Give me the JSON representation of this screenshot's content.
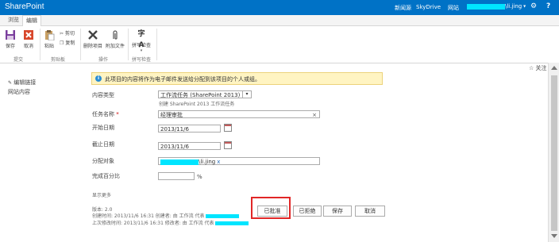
{
  "topbar": {
    "brand": "SharePoint",
    "links": [
      "新闻源",
      "SkyDrive",
      "网站"
    ],
    "user_suffix": "\\li.jing",
    "gear_icon": "gear-icon",
    "help_icon": "?"
  },
  "tabs": [
    "浏览",
    "编辑"
  ],
  "ribbon": {
    "buttons": {
      "save": "保存",
      "cancel": "取消",
      "paste": "粘贴",
      "cut": "剪切",
      "copy": "复制",
      "delete_item": "删除项目",
      "attach_file": "附加文件",
      "spelling": "拼写检查"
    },
    "groups": {
      "commit": "提交",
      "clipboard": "剪贴板",
      "actions": "操作",
      "spelling": "拼写检查"
    }
  },
  "follow": "关注",
  "leftnav": [
    "编辑链接",
    "网站内容"
  ],
  "info_message": "此项目的内容将作为电子邮件发送给分配到该项目的个人或组。",
  "form": {
    "content_type_label": "内容类型",
    "content_type_value": "工作流任务 (SharePoint 2013)",
    "content_type_desc": "创建 SharePoint 2013 工作流任务",
    "title_label": "任务名称",
    "title_required": "*",
    "title_value": "经理审批",
    "start_label": "开始日期",
    "start_value": "2013/11/6",
    "due_label": "截止日期",
    "due_value": "2013/11/6",
    "assigned_label": "分配对象",
    "assigned_suffix": "\\li.jing",
    "percent_label": "完成百分比",
    "percent_unit": "%",
    "show_more": "显示更多"
  },
  "buttons": {
    "approve": "已批准",
    "reject": "已拒绝",
    "save": "保存",
    "cancel": "取消"
  },
  "meta": {
    "version": "版本: 2.0",
    "created": "创建时间: 2013/11/6 16:31  创建者: 由 工作流 代表",
    "modified": "上次修改时间: 2013/11/6 16:31  修改者: 由 工作流 代表"
  },
  "colors": {
    "topbar": "#0072c6",
    "info_bg": "#fff4c2",
    "highlight": "#e12727",
    "redaction": "#00e5ff"
  }
}
